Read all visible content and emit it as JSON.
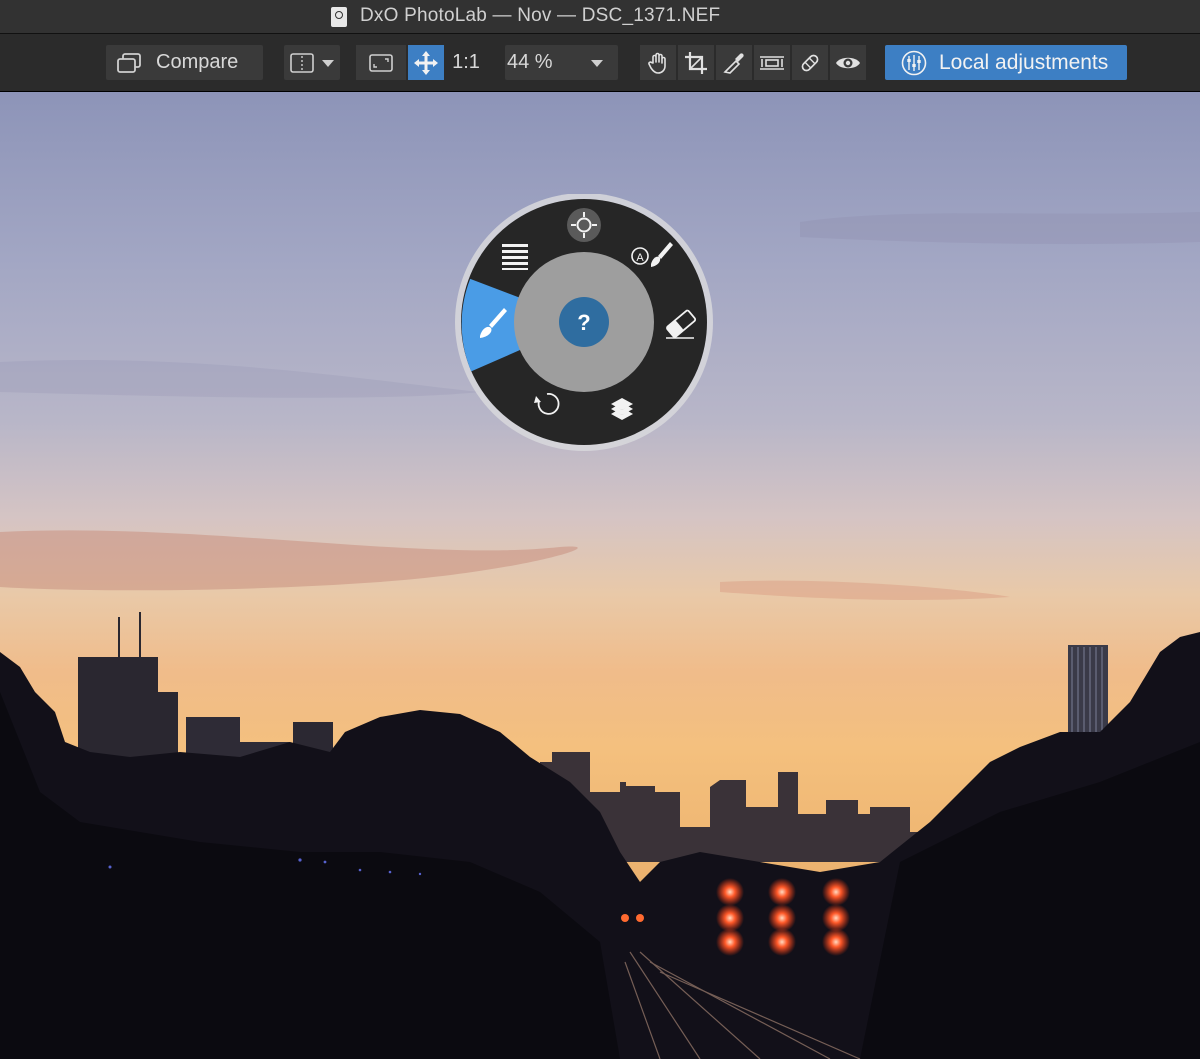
{
  "window": {
    "title": "DxO PhotoLab — Nov — DSC_1371.NEF"
  },
  "toolbar": {
    "compare_label": "Compare",
    "zoom_one_to_one": "1:1",
    "zoom_value": "44 %",
    "local_adjustments_label": "Local adjustments",
    "icons": [
      "compare-icon",
      "split-view-icon",
      "chevron-down-icon",
      "fit-screen-icon",
      "move-icon",
      "hand-icon",
      "crop-icon",
      "eyedropper-icon",
      "horizon-icon",
      "repair-icon",
      "eye-icon",
      "local-adjustments-icon"
    ]
  },
  "wheel": {
    "center_label": "?",
    "tools": [
      "control-point-icon",
      "auto-mask-brush-icon",
      "eraser-icon",
      "layers-icon",
      "undo-icon",
      "brush-icon",
      "graduated-filter-icon"
    ],
    "active_tool": "brush-icon",
    "accent_color": "#4a9ce6"
  },
  "colors": {
    "accent": "#3d7fc4",
    "toolbar_bg": "#2b2b2b",
    "titlebar_bg": "#323232"
  }
}
